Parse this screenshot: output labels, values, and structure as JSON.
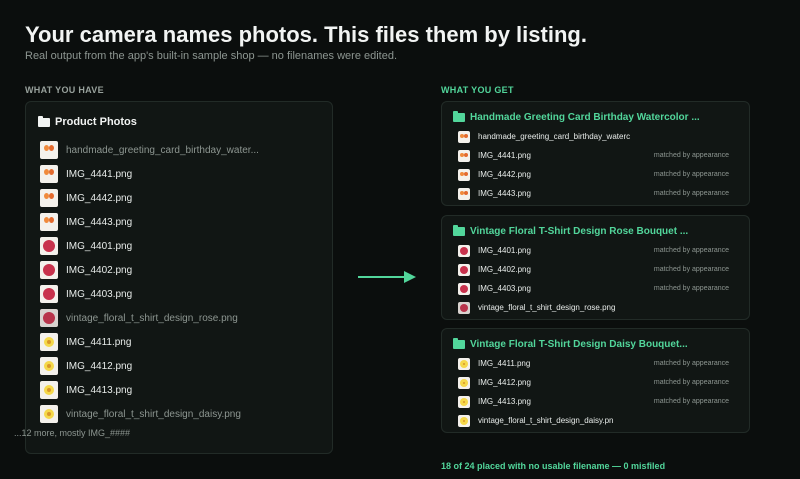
{
  "header": {
    "title": "Your camera names photos. This files them by listing.",
    "subtitle": "Real output from the app's built-in sample shop — no filenames were edited."
  },
  "have": {
    "label": "WHAT YOU HAVE",
    "folder_name": "Product Photos",
    "folder_icon": "folder-icon",
    "items": [
      {
        "name": "handmade_greeting_card_birthday_water...",
        "thumb": "balloon",
        "muted": true
      },
      {
        "name": "IMG_4441.png",
        "thumb": "balloon",
        "muted": false
      },
      {
        "name": "IMG_4442.png",
        "thumb": "balloon",
        "muted": false
      },
      {
        "name": "IMG_4443.png",
        "thumb": "balloon",
        "muted": false
      },
      {
        "name": "IMG_4401.png",
        "thumb": "rose",
        "muted": false
      },
      {
        "name": "IMG_4402.png",
        "thumb": "rose",
        "muted": false
      },
      {
        "name": "IMG_4403.png",
        "thumb": "rose",
        "muted": false
      },
      {
        "name": "vintage_floral_t_shirt_design_rose.png",
        "thumb": "rose photo",
        "muted": true
      },
      {
        "name": "IMG_4411.png",
        "thumb": "daisy",
        "muted": false
      },
      {
        "name": "IMG_4412.png",
        "thumb": "daisy",
        "muted": false
      },
      {
        "name": "IMG_4413.png",
        "thumb": "daisy",
        "muted": false
      },
      {
        "name": "vintage_floral_t_shirt_design_daisy.png",
        "thumb": "daisy",
        "muted": true
      }
    ],
    "more_note": "...12 more, mostly IMG_####"
  },
  "arrow": {
    "icon": "arrow-right-icon",
    "color": "#52d69b"
  },
  "get": {
    "label": "WHAT YOU GET",
    "groups": [
      {
        "title": "Handmade Greeting Card Birthday Watercolor ...",
        "items": [
          {
            "name": "handmade_greeting_card_birthday_waterc",
            "thumb": "balloon",
            "match": ""
          },
          {
            "name": "IMG_4441.png",
            "thumb": "balloon",
            "match": "matched by appearance"
          },
          {
            "name": "IMG_4442.png",
            "thumb": "balloon",
            "match": "matched by appearance"
          },
          {
            "name": "IMG_4443.png",
            "thumb": "balloon",
            "match": "matched by appearance"
          }
        ]
      },
      {
        "title": "Vintage Floral T-Shirt Design Rose Bouquet ...",
        "items": [
          {
            "name": "IMG_4401.png",
            "thumb": "rose",
            "match": "matched by appearance"
          },
          {
            "name": "IMG_4402.png",
            "thumb": "rose",
            "match": "matched by appearance"
          },
          {
            "name": "IMG_4403.png",
            "thumb": "rose",
            "match": "matched by appearance"
          },
          {
            "name": "vintage_floral_t_shirt_design_rose.png",
            "thumb": "rose photo",
            "match": ""
          }
        ]
      },
      {
        "title": "Vintage Floral T-Shirt Design Daisy Bouquet...",
        "items": [
          {
            "name": "IMG_4411.png",
            "thumb": "daisy",
            "match": "matched by appearance"
          },
          {
            "name": "IMG_4412.png",
            "thumb": "daisy",
            "match": "matched by appearance"
          },
          {
            "name": "IMG_4413.png",
            "thumb": "daisy",
            "match": "matched by appearance"
          },
          {
            "name": "vintage_floral_t_shirt_design_daisy.pn",
            "thumb": "daisy",
            "match": ""
          }
        ]
      }
    ]
  },
  "footer": {
    "summary": "18 of 24 placed with no usable filename — 0 misfiled"
  },
  "colors": {
    "background": "#0b0e0d",
    "panel": "#111614",
    "accent": "#52d69b",
    "muted_text": "#8d9691"
  }
}
